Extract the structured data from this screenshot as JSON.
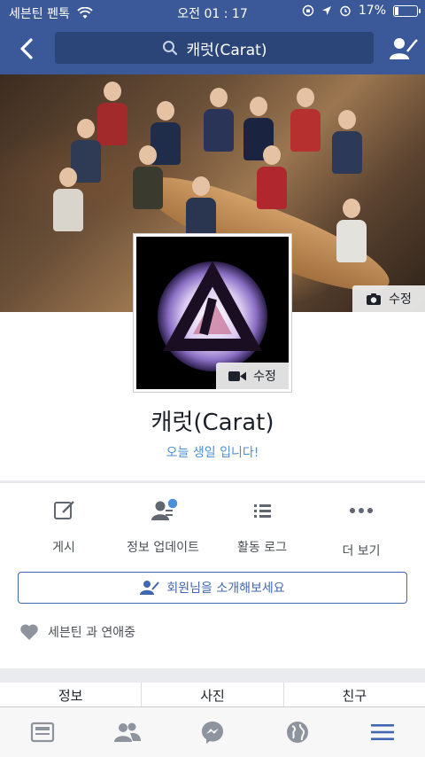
{
  "status_bar": {
    "carrier": "세븐틴 펜톡",
    "time": "오전 01 : 17",
    "battery_percent": "17%",
    "battery_level": 0.17
  },
  "nav": {
    "search_text": "캐럿(Carat)",
    "back_icon": "chevron-left-icon",
    "friend_icon": "add-friend-icon"
  },
  "cover": {
    "edit_label": "수정"
  },
  "profile": {
    "avatar_edit_label": "수정",
    "name": "캐럿(Carat)",
    "birthday_text": "오늘 생일 입니다!"
  },
  "actions": [
    {
      "label": "게시",
      "icon": "compose-icon"
    },
    {
      "label": "정보 업데이트",
      "icon": "update-info-icon"
    },
    {
      "label": "활동 로그",
      "icon": "activity-log-icon"
    },
    {
      "label": "더 보기",
      "icon": "more-icon"
    }
  ],
  "intro_button": "회원님을 소개해보세요",
  "relationship": "세븐틴 과 연애중",
  "tabs": [
    "정보",
    "사진",
    "친구"
  ],
  "bottom_nav": [
    "news-feed-icon",
    "friends-icon",
    "messenger-icon",
    "globe-icon",
    "menu-icon"
  ],
  "colors": {
    "brand": "#3b5998",
    "link": "#4267b2",
    "birthday": "#4a90d9",
    "active_tab": "#4267b2"
  }
}
